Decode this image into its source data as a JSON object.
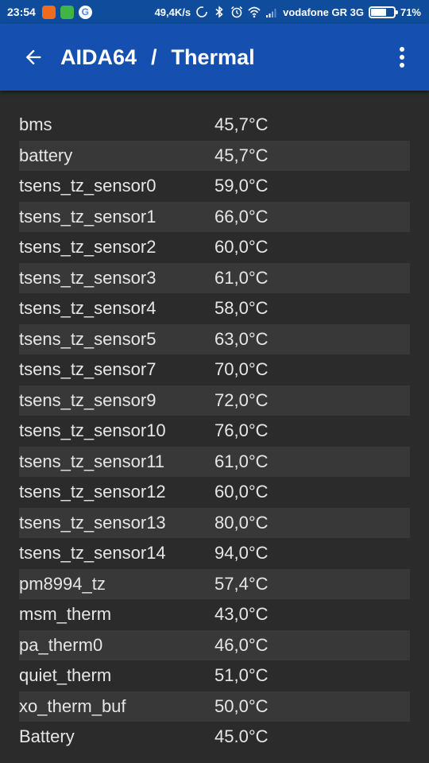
{
  "status_bar": {
    "time": "23:54",
    "net_speed": "49,4K/s",
    "carrier": "vodafone GR 3G",
    "battery_percent": "71%",
    "battery_level": 0.71,
    "icons": [
      "orange-app-icon",
      "green-app-icon",
      "google-icon",
      "sync-icon",
      "bluetooth-icon",
      "alarm-icon",
      "wifi-icon",
      "signal-icon",
      "battery-icon"
    ]
  },
  "app_bar": {
    "app_name": "AIDA64",
    "separator": "/",
    "section": "Thermal"
  },
  "colors": {
    "app_bar": "#1550b0",
    "status_bar": "#0f4d9c",
    "background": "#2b2b2b",
    "row_alt": "#383838",
    "text": "#e6e6e6"
  },
  "sensors": [
    {
      "name": "bms",
      "value": "45,7°C"
    },
    {
      "name": "battery",
      "value": "45,7°C"
    },
    {
      "name": "tsens_tz_sensor0",
      "value": "59,0°C"
    },
    {
      "name": "tsens_tz_sensor1",
      "value": "66,0°C"
    },
    {
      "name": "tsens_tz_sensor2",
      "value": "60,0°C"
    },
    {
      "name": "tsens_tz_sensor3",
      "value": "61,0°C"
    },
    {
      "name": "tsens_tz_sensor4",
      "value": "58,0°C"
    },
    {
      "name": "tsens_tz_sensor5",
      "value": "63,0°C"
    },
    {
      "name": "tsens_tz_sensor7",
      "value": "70,0°C"
    },
    {
      "name": "tsens_tz_sensor9",
      "value": "72,0°C"
    },
    {
      "name": "tsens_tz_sensor10",
      "value": "76,0°C"
    },
    {
      "name": "tsens_tz_sensor11",
      "value": "61,0°C"
    },
    {
      "name": "tsens_tz_sensor12",
      "value": "60,0°C"
    },
    {
      "name": "tsens_tz_sensor13",
      "value": "80,0°C"
    },
    {
      "name": "tsens_tz_sensor14",
      "value": "94,0°C"
    },
    {
      "name": "pm8994_tz",
      "value": "57,4°C"
    },
    {
      "name": "msm_therm",
      "value": "43,0°C"
    },
    {
      "name": "pa_therm0",
      "value": "46,0°C"
    },
    {
      "name": "quiet_therm",
      "value": "51,0°C"
    },
    {
      "name": "xo_therm_buf",
      "value": "50,0°C"
    },
    {
      "name": "Battery",
      "value": "45.0°C"
    }
  ]
}
